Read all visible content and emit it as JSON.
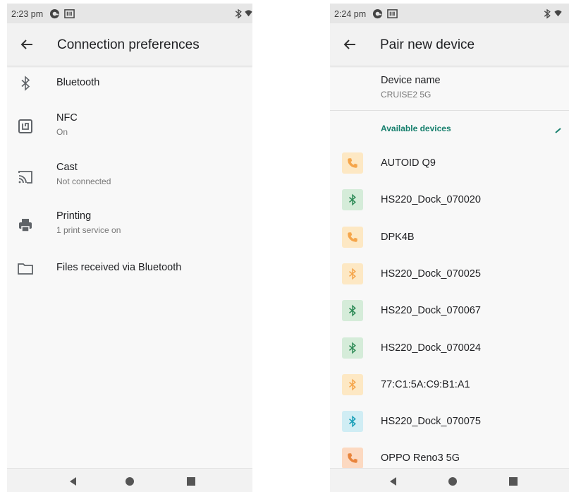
{
  "left_screen": {
    "status": {
      "time": "2:23 pm"
    },
    "title": "Connection preferences",
    "items": [
      {
        "title": "Bluetooth",
        "subtitle": "",
        "icon": "bluetooth-icon"
      },
      {
        "title": "NFC",
        "subtitle": "On",
        "icon": "nfc-icon"
      },
      {
        "title": "Cast",
        "subtitle": "Not connected",
        "icon": "cast-icon"
      },
      {
        "title": "Printing",
        "subtitle": "1 print service on",
        "icon": "printer-icon"
      },
      {
        "title": "Files received via Bluetooth",
        "subtitle": "",
        "icon": "folder-icon"
      }
    ]
  },
  "right_screen": {
    "status": {
      "time": "2:24 pm"
    },
    "title": "Pair new device",
    "device_name_label": "Device name",
    "device_name_value": "CRUISE2 5G",
    "available_label": "Available devices",
    "devices": [
      {
        "name": "AUTOID Q9",
        "icon": "phone-icon",
        "color": "#f5a54a",
        "bg": "#fde8c4"
      },
      {
        "name": "HS220_Dock_070020",
        "icon": "bluetooth-icon",
        "color": "#2e8b57",
        "bg": "#d5ecd9"
      },
      {
        "name": "DPK4B",
        "icon": "phone-icon",
        "color": "#f5a54a",
        "bg": "#fde8c4"
      },
      {
        "name": "HS220_Dock_070025",
        "icon": "bluetooth-icon",
        "color": "#f5a54a",
        "bg": "#fde8c4"
      },
      {
        "name": "HS220_Dock_070067",
        "icon": "bluetooth-icon",
        "color": "#2e8b57",
        "bg": "#d5ecd9"
      },
      {
        "name": "HS220_Dock_070024",
        "icon": "bluetooth-icon",
        "color": "#2e8b57",
        "bg": "#d5ecd9"
      },
      {
        "name": "77:C1:5A:C9:B1:A1",
        "icon": "bluetooth-icon",
        "color": "#f5a54a",
        "bg": "#fde8c4"
      },
      {
        "name": "HS220_Dock_070075",
        "icon": "bluetooth-icon",
        "color": "#1a9fb8",
        "bg": "#d0edf4"
      },
      {
        "name": "OPPO Reno3 5G",
        "icon": "phone-icon",
        "color": "#e8843c",
        "bg": "#fcd9c1"
      }
    ]
  },
  "colors": {
    "accent": "#18806e",
    "status_bar": "#e6e6e6",
    "app_bar": "#f2f2f2"
  }
}
